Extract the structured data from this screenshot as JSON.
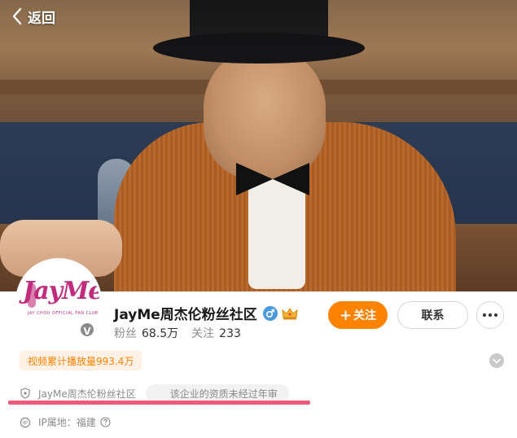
{
  "topbar": {
    "back_label": "返回"
  },
  "profile": {
    "name": "JayMe周杰伦粉丝社区",
    "avatar_logo_text": "JayMe",
    "avatar_logo_subtext": "JAY CHOU OFFICIAL FAN CLUB",
    "verified_badge": "V",
    "stats": {
      "fans_label": "粉丝",
      "fans_value": "68.5万",
      "following_label": "关注",
      "following_value": "233"
    },
    "tag": "视频累计播放量993.4万",
    "info": {
      "verification_name": "JayMe周杰伦粉丝社区",
      "notice": "该企业的资质未经过年审",
      "ip_location": "IP属地：福建"
    }
  },
  "actions": {
    "follow_plus": "+",
    "follow_label": "关注",
    "contact_label": "联系"
  },
  "icons": {
    "back": "chevron-left-icon",
    "gender": "male-icon",
    "crown": "crown-icon",
    "more": "more-dots-icon",
    "expand": "chevron-down-icon",
    "shield": "shield-icon",
    "ip": "location-ip-icon",
    "help": "question-icon"
  },
  "colors": {
    "accent": "#ff8200",
    "tag_bg": "#fff1e5",
    "underline": "#f05a7a",
    "brand": "#c12b7c"
  }
}
